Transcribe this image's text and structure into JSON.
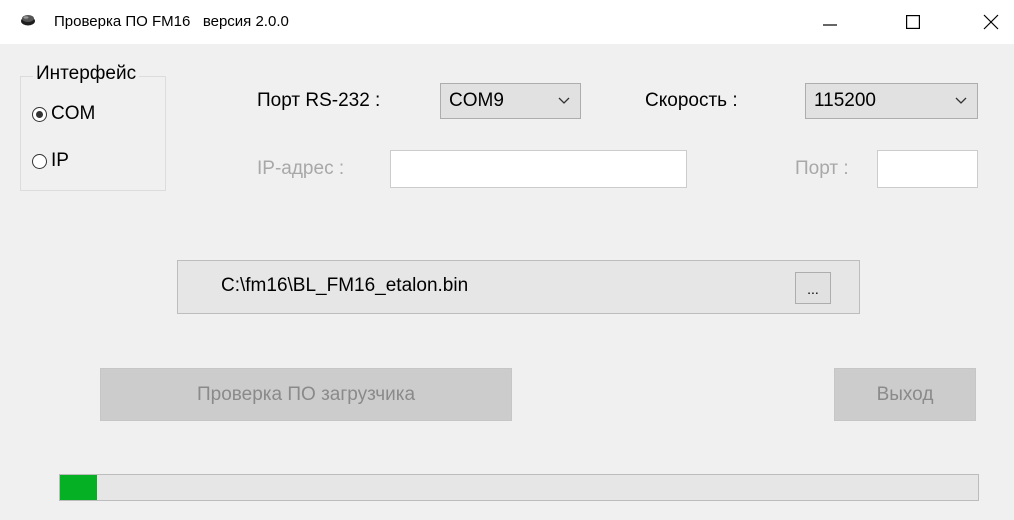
{
  "window": {
    "title": "Проверка ПО FM16   версия 2.0.0",
    "app_icon": "app-icon",
    "controls": [
      "minimize-icon",
      "maximize-icon",
      "close-icon"
    ]
  },
  "interface_group": {
    "legend": "Интерфейс",
    "options": [
      {
        "label": "COM",
        "selected": true
      },
      {
        "label": "IP",
        "selected": false
      }
    ]
  },
  "serial": {
    "port_label": "Порт RS-232 :",
    "port_value": "COM9",
    "speed_label": "Скорость :",
    "speed_value": "115200"
  },
  "network": {
    "ip_label": "IP-адрес :",
    "ip_value": "",
    "port_label": "Порт :",
    "port_value": ""
  },
  "file": {
    "path": "C:\\fm16\\BL_FM16_etalon.bin",
    "browse_label": "..."
  },
  "actions": {
    "check_label": "Проверка ПО загрузчика",
    "exit_label": "Выход"
  },
  "progress": {
    "value": 0.04,
    "color": "#06b025"
  }
}
